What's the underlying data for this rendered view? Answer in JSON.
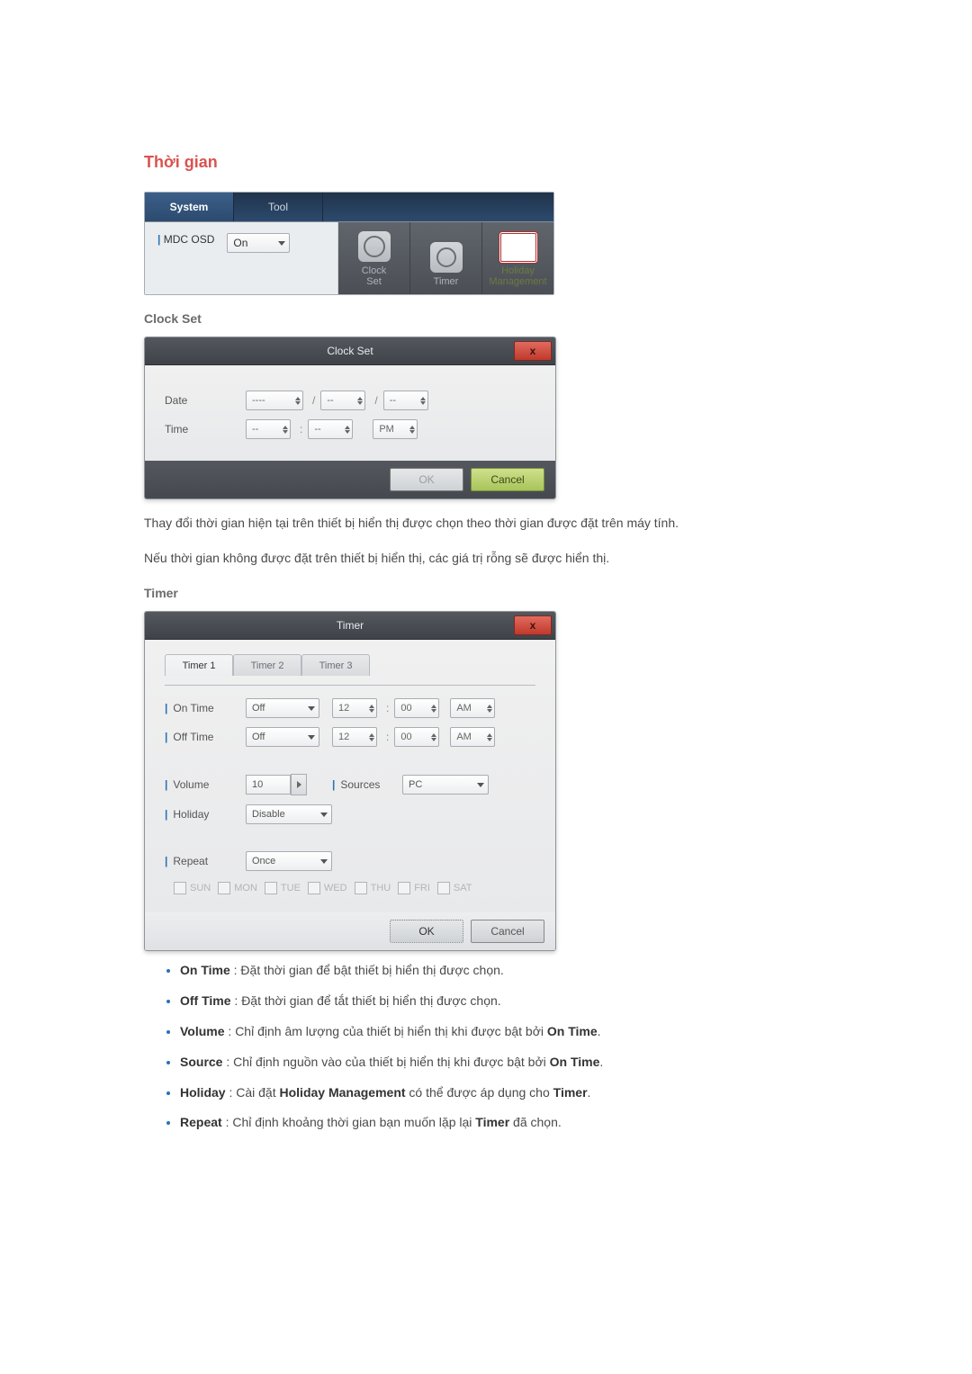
{
  "title": "Thời gian",
  "toolbar": {
    "tab_system": "System",
    "tab_tool": "Tool",
    "osd_label": "MDC OSD",
    "osd_value": "On",
    "icons": {
      "clock_set": "Clock\nSet",
      "timer": "Timer",
      "holiday": "Holiday\nManagement"
    }
  },
  "clock_set": {
    "heading": "Clock Set",
    "dialog_title": "Clock Set",
    "date_label": "Date",
    "time_label": "Time",
    "date_y": "----",
    "date_m": "--",
    "date_d": "--",
    "time_h": "--",
    "time_m": "--",
    "ampm": "PM",
    "slash": "/",
    "colon": ":",
    "ok": "OK",
    "cancel": "Cancel",
    "desc1": "Thay đổi thời gian hiện tại trên thiết bị hiển thị được chọn theo thời gian được đặt trên máy tính.",
    "desc2": "Nếu thời gian không được đặt trên thiết bị hiển thị, các giá trị rỗng sẽ được hiển thị."
  },
  "timer": {
    "heading": "Timer",
    "dialog_title": "Timer",
    "tabs": [
      "Timer 1",
      "Timer 2",
      "Timer 3"
    ],
    "labels": {
      "on_time": "On Time",
      "off_time": "Off Time",
      "volume": "Volume",
      "sources": "Sources",
      "holiday": "Holiday",
      "repeat": "Repeat"
    },
    "values": {
      "on_off_state": "Off",
      "hours": "12",
      "minutes": "00",
      "ampm": "AM",
      "volume": "10",
      "sources": "PC",
      "holiday": "Disable",
      "repeat": "Once"
    },
    "days": [
      "SUN",
      "MON",
      "TUE",
      "WED",
      "THU",
      "FRI",
      "SAT"
    ],
    "ok": "OK",
    "cancel": "Cancel",
    "colon": ":"
  },
  "bullets": {
    "on_time_b": "On Time",
    "on_time_t": " : Đặt thời gian để bật thiết bị hiển thị được chọn.",
    "off_time_b": "Off Time",
    "off_time_t": " : Đặt thời gian để tắt thiết bị hiển thị được chọn.",
    "volume_b": "Volume",
    "volume_t1": " : Chỉ định âm lượng của thiết bị hiển thị khi được bật bởi ",
    "volume_b2": "On Time",
    "volume_t2": ".",
    "source_b": "Source",
    "source_t1": " : Chỉ định nguồn vào của thiết bị hiển thị khi được bật bởi ",
    "source_b2": "On Time",
    "source_t2": ".",
    "holiday_b": "Holiday",
    "holiday_t1": " : Cài đặt ",
    "holiday_b2": "Holiday Management",
    "holiday_t2": " có thể được áp dụng cho ",
    "holiday_b3": "Timer",
    "holiday_t3": ".",
    "repeat_b": "Repeat",
    "repeat_t1": " : Chỉ định khoảng thời gian bạn muốn lặp lại ",
    "repeat_b2": "Timer",
    "repeat_t2": " đã chọn."
  }
}
